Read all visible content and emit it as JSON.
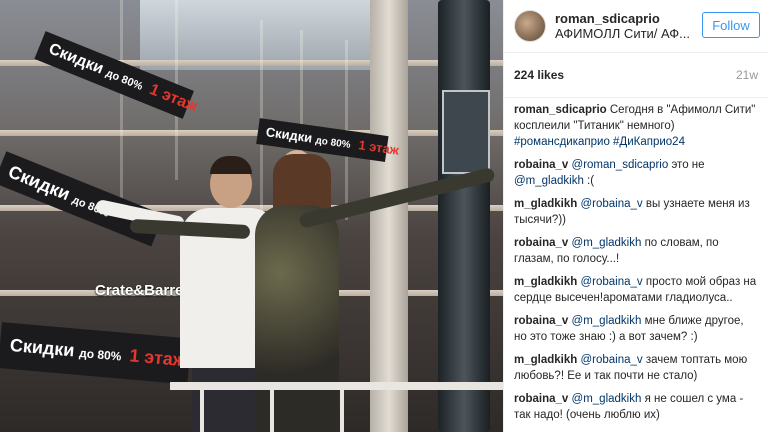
{
  "photo": {
    "signs": [
      {
        "text": "Скидки",
        "sub": "до 80%",
        "floor": "1 этаж"
      },
      {
        "text": "Скидки",
        "sub": "до 80%",
        "floor": "1 этаж"
      },
      {
        "text": "Скидки",
        "sub": "до 80%",
        "floor": ""
      },
      {
        "text": "Скидки",
        "sub": "до 80%",
        "floor": "1 этаж"
      }
    ],
    "store_sign": "Crate&Barrel"
  },
  "post": {
    "username": "roman_sdicaprio",
    "location": "АФИМОЛЛ Сити/ АФ...",
    "follow_label": "Follow",
    "likes": "224 likes",
    "age": "21w"
  },
  "comments": [
    {
      "user": "roman_sdicaprio",
      "text": "Сегодня в \"Афимолл Сити\" косплеили \"Титаник\" немного)",
      "mention": "#романсдикаприо #ДиКаприо24"
    },
    {
      "user": "robaina_v",
      "mention": "@roman_sdicaprio",
      "text": "это не",
      "mention2": "@m_gladkikh",
      "text2": ":("
    },
    {
      "user": "m_gladkikh",
      "mention": "@robaina_v",
      "text": "вы узнаете меня из тысячи?))"
    },
    {
      "user": "robaina_v",
      "mention": "@m_gladkikh",
      "text": "по словам, по глазам, по голосу...!"
    },
    {
      "user": "m_gladkikh",
      "mention": "@robaina_v",
      "text": "просто мой образ на сердце высечен!ароматами гладиолуса.."
    },
    {
      "user": "robaina_v",
      "mention": "@m_gladkikh",
      "text": "мне ближе другое, но это тоже знаю :) а вот зачем? :)"
    },
    {
      "user": "m_gladkikh",
      "mention": "@robaina_v",
      "text": "зачем топтать мою любовь?! Ее и так почти не стало)"
    },
    {
      "user": "robaina_v",
      "mention": "@m_gladkikh",
      "text": "я не сошел с ума - так надо! (очень люблю их)"
    }
  ]
}
